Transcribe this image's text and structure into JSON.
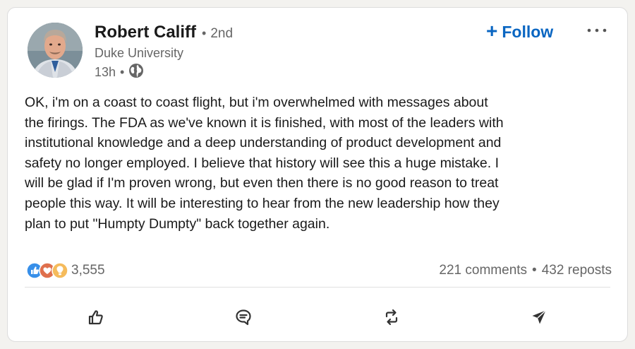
{
  "author": {
    "name": "Robert Califf",
    "degree": "2nd",
    "headline": "Duke University",
    "time": "13h",
    "visibility_icon": "globe-icon"
  },
  "follow": {
    "label": "Follow",
    "icon": "plus-icon",
    "color": "#0a66c2"
  },
  "more": {
    "icon": "ellipsis-icon"
  },
  "post": {
    "text": "OK, i'm on a coast to coast flight, but i'm overwhelmed with messages about\nthe firings. The FDA as we've known it is finished, with most of the leaders with\ninstitutional knowledge and a deep understanding of product development and\nsafety no longer employed. I believe that history will see this a huge mistake. I\nwill be glad if I'm proven wrong, but even then there is no good reason to treat\npeople this way. It will be interesting to hear from the new leadership how they\nplan to put \"Humpty Dumpty\" back together again."
  },
  "social": {
    "reaction_icons": [
      "like-icon",
      "love-icon",
      "insightful-icon"
    ],
    "reaction_count": "3,555",
    "comments": "221 comments",
    "reposts": "432 reposts"
  },
  "actions": [
    {
      "name": "like",
      "icon": "thumbs-up-icon"
    },
    {
      "name": "comment",
      "icon": "comment-icon"
    },
    {
      "name": "repost",
      "icon": "repost-icon"
    },
    {
      "name": "send",
      "icon": "send-icon"
    }
  ]
}
